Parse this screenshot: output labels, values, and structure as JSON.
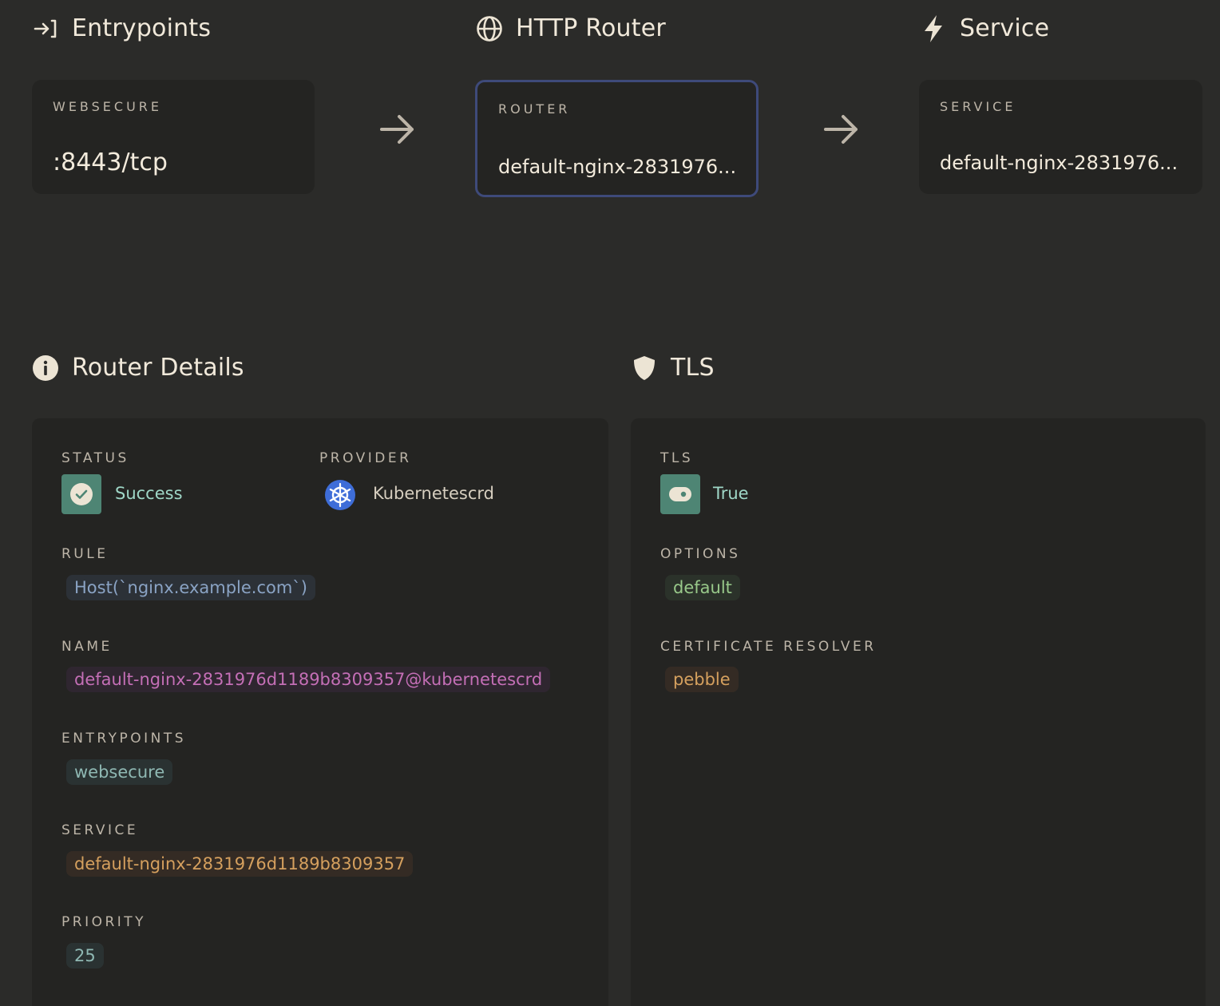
{
  "flow": {
    "entrypoints": {
      "title": "Entrypoints",
      "caption": "WEBSECURE",
      "value": ":8443/tcp"
    },
    "router": {
      "title": "HTTP Router",
      "caption": "ROUTER",
      "value": "default-nginx-2831976..."
    },
    "service": {
      "title": "Service",
      "caption": "SERVICE",
      "value": "default-nginx-2831976..."
    }
  },
  "router_details": {
    "title": "Router Details",
    "status_label": "STATUS",
    "status_value": "Success",
    "provider_label": "PROVIDER",
    "provider_value": "Kubernetescrd",
    "rule_label": "RULE",
    "rule_value": "Host(`nginx.example.com`)",
    "name_label": "NAME",
    "name_value": "default-nginx-2831976d1189b8309357@kubernetescrd",
    "entrypoints_label": "ENTRYPOINTS",
    "entrypoints_value": "websecure",
    "service_label": "SERVICE",
    "service_value": "default-nginx-2831976d1189b8309357",
    "priority_label": "PRIORITY",
    "priority_value": "25"
  },
  "tls": {
    "title": "TLS",
    "tls_label": "TLS",
    "tls_value": "True",
    "options_label": "OPTIONS",
    "options_value": "default",
    "resolver_label": "CERTIFICATE RESOLVER",
    "resolver_value": "pebble"
  },
  "colors": {
    "background": "#2b2b29",
    "card": "#242422",
    "accent_border": "#3e4a7a",
    "success": "#4e8574",
    "rule_text": "#8aa3c4",
    "name_text": "#c46fb6",
    "entrypoint_text": "#8fb8b3",
    "service_text": "#d5a05e",
    "options_text": "#98c98a",
    "resolver_text": "#d5a05e"
  },
  "icons": {
    "entrypoints": "sign-in-icon",
    "router": "globe-icon",
    "service": "lightning-icon",
    "router_details": "info-icon",
    "tls": "shield-icon",
    "status": "check-circle-icon",
    "provider": "kubernetes-icon",
    "tls_toggle": "toggle-icon",
    "flow_arrow": "arrow-right-icon"
  }
}
